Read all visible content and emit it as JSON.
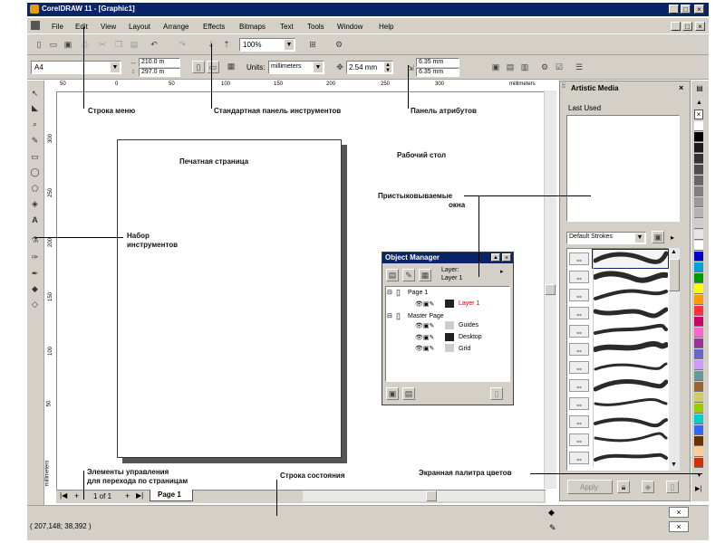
{
  "window": {
    "title": "CorelDRAW 11 - [Graphic1]",
    "controls": [
      "_",
      "□",
      "×"
    ]
  },
  "menu": {
    "items": [
      "File",
      "Edit",
      "View",
      "Layout",
      "Arrange",
      "Effects",
      "Bitmaps",
      "Text",
      "Tools",
      "Window",
      "Help"
    ]
  },
  "standard_toolbar": {
    "zoom": "100%"
  },
  "property_bar": {
    "paper": "A4",
    "width": "210.0 m",
    "height": "297.0 m",
    "units_label": "Units:",
    "units": "millimeters",
    "nudge": "2.54 mm",
    "dup_x": "6.35 mm",
    "dup_y": "6.35 mm"
  },
  "ruler": {
    "h_ticks": [
      "50",
      "0",
      "50",
      "100",
      "150",
      "200",
      "250",
      "300"
    ],
    "h_unit": "millimeters",
    "v_ticks": [
      "300",
      "250",
      "200",
      "150",
      "100",
      "50"
    ],
    "v_unit": "millimeters"
  },
  "docker": {
    "title": "Artistic Media",
    "last_used": "Last Used",
    "stroke_category": "Default Strokes",
    "apply": "Apply"
  },
  "object_manager": {
    "title": "Object Manager",
    "layer_label": "Layer:",
    "layer_name": "Layer 1",
    "page": "Page 1",
    "page_layer": "Layer 1",
    "master": "Master Page",
    "master_layers": [
      "Guides",
      "Desktop",
      "Grid"
    ]
  },
  "page_nav": {
    "count": "1 of 1",
    "tab": "Page 1"
  },
  "status": {
    "coords": "( 207,148; 38,392 )"
  },
  "callouts": {
    "menu_bar": "Строка меню",
    "standard_toolbar": "Стандартная панель инструментов",
    "property_bar": "Панель атрибутов",
    "printable_page": "Печатная страница",
    "desktop": "Рабочий стол",
    "dockers_line1": "Пристыковываемые",
    "dockers_line2": "окна",
    "toolbox_line1": "Набор",
    "toolbox_line2": "инструментов",
    "page_nav_line1": "Элементы управления",
    "page_nav_line2": "для перехода по страницам",
    "status_bar": "Строка состояния",
    "palette": "Экранная палитра цветов"
  },
  "colors": {
    "title_bar": "#0a246a",
    "chrome": "#d4d0c8",
    "layer_red": "#cc0000"
  },
  "palette_colors": [
    "#ffffff",
    "#000000",
    "#1a1a1a",
    "#333333",
    "#4d4d4d",
    "#666666",
    "#808080",
    "#999999",
    "#b3b3b3",
    "#cccccc",
    "#e6e6e6",
    "#ffffff",
    "#0000cc",
    "#00a0e0",
    "#009900",
    "#ffff00",
    "#ff9900",
    "#ff3333",
    "#cc0066",
    "#ff66cc",
    "#993399",
    "#6666cc",
    "#cc99ff",
    "#669999",
    "#996633",
    "#cccc66",
    "#99cc00",
    "#00cccc",
    "#3366ff",
    "#663300",
    "#ffcc99",
    "#cc3300"
  ]
}
